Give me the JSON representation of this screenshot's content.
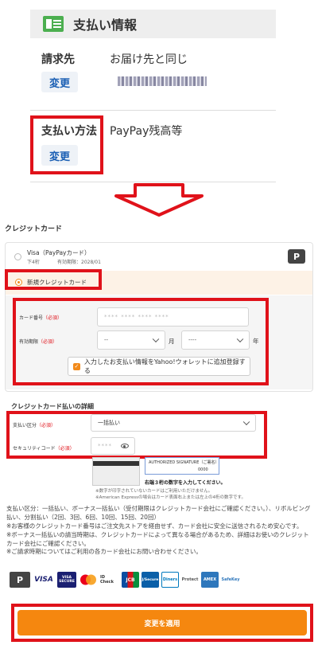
{
  "payment_info": {
    "title": "支払い情報",
    "billing": {
      "label": "請求先",
      "value": "お届け先と同じ",
      "change": "変更"
    },
    "method": {
      "label": "支払い方法",
      "value": "PayPay残高等",
      "change": "変更"
    }
  },
  "credit": {
    "title": "クレジットカード",
    "saved_card": {
      "name": "Visa（PayPayカード）",
      "last4": "下4桁",
      "expiry": "有効期限：2028/01",
      "logo": "P"
    },
    "new_card_label": "新規クレジットカード",
    "card_number": {
      "label": "カード番号",
      "required": "（必須）",
      "placeholder": "**** **** **** ****"
    },
    "expiry": {
      "label": "有効期限",
      "required": "（必須）",
      "month": "--",
      "month_unit": "月",
      "year": "----",
      "year_unit": "年"
    },
    "register_checkbox": "入力したお支払い情報をYahoo!ウォレットに追加登録する",
    "check_mark": "✓"
  },
  "detail": {
    "title": "クレジットカード払いの詳細",
    "installment": {
      "label": "支払い区分",
      "required": "（必須）",
      "value": "一括払い"
    },
    "security": {
      "label": "セキュリティコード",
      "required": "（必須）",
      "placeholder": "****"
    },
    "sig_label": "AUTHORIZED SIGNATURE（ご署名）",
    "sig_digits": "0000",
    "hint": "右端３桁の数字を入力してください。",
    "note1": "※数字が印字されていないカードはご利用いただけません。",
    "note2": "※American Expressの場合はカード表面右上または左上の4桁の数字です。"
  },
  "notes": [
    "支払い区分：一括払い、ボーナス一括払い（受付期限はクレジットカード会社にご確認ください。）、リボルビング払い、分割払い（2回、3回、6回、10回、15回、20回）",
    "※お客様のクレジットカード番号はご注文先ストアを経由せず、カード会社に安全に送信されるため安心です。",
    "※ボーナス一括払いの請当時期は、クレジットカードによって異なる場合があるため、詳細はお使いのクレジットカード会社にご確認ください。",
    "※ご請求時期についてはご利用の各カード会社にお問い合わせください。"
  ],
  "logos": [
    "P",
    "VISA",
    "VISA SECURE",
    "mc",
    "ID Check",
    "JCB",
    "J/Secure",
    "Diners",
    "Protect",
    "AMEX",
    "SafeKey"
  ],
  "apply_button": "変更を適用",
  "colors": {
    "accent": "#f5870f",
    "highlight": "#e0121a",
    "link": "#1a5fb4"
  }
}
